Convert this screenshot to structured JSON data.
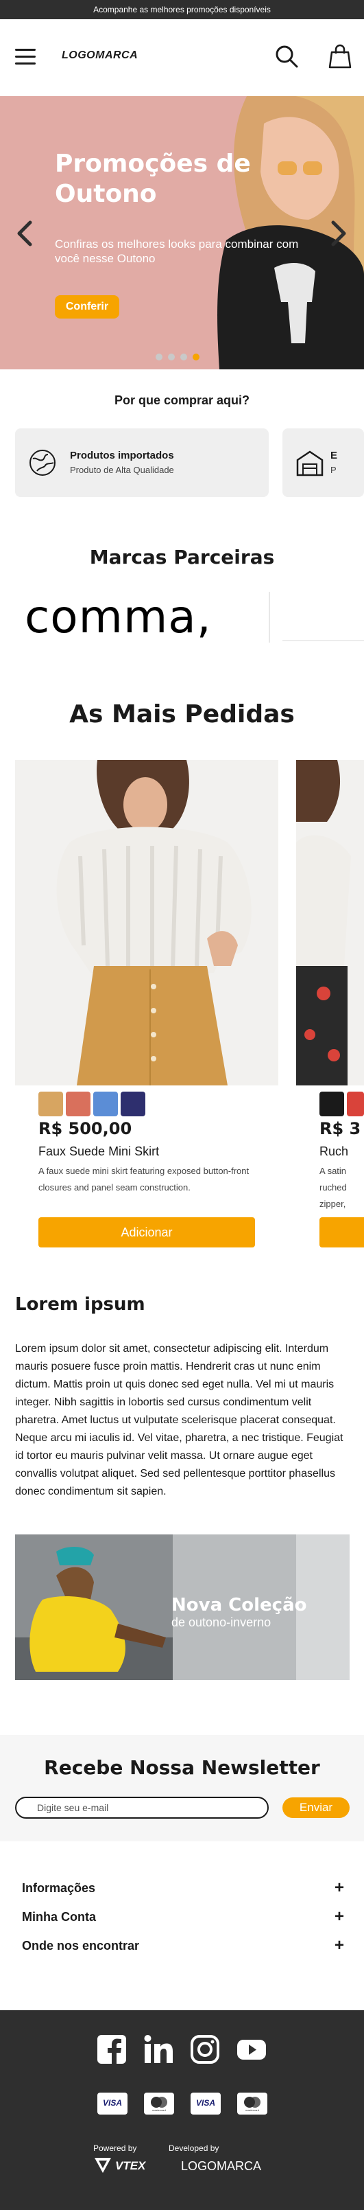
{
  "topbar": {
    "message": "Acompanhe as melhores promoções disponíveis"
  },
  "header": {
    "logo": "LOGOMARCA",
    "icons": [
      "menu-icon",
      "search-icon",
      "bag-icon"
    ]
  },
  "hero": {
    "title": "Promoções de Outono",
    "subtitle": "Confiras os melhores looks para combinar com você nesse Outono",
    "button": "Conferir",
    "slides": 4,
    "active_slide": 4
  },
  "why": {
    "title": "Por que comprar aqui?",
    "features": [
      {
        "title": "Produtos importados",
        "subtitle": "Produto de Alta Qualidade",
        "icon": "globe-icon"
      },
      {
        "title": "E",
        "subtitle": "P",
        "icon": "warehouse-icon"
      }
    ]
  },
  "brands": {
    "title": "Marcas Parceiras",
    "items": [
      "comma,"
    ]
  },
  "bestsellers": {
    "title": "As Mais Pedidas",
    "products": [
      {
        "colors": [
          "#D7A561",
          "#D9705C",
          "#5B8DD6",
          "#2E2F6E"
        ],
        "price": "R$ 500,00",
        "name": "Faux Suede Mini Skirt",
        "description": "A faux suede mini skirt featuring exposed button-front closures and panel seam construction.",
        "button": "Adicionar"
      },
      {
        "colors": [
          "#1A1A1A",
          "#D9433A"
        ],
        "price": "R$ 3",
        "name": "Ruch",
        "description": "A satin\nruched\nzipper,",
        "button": ""
      }
    ]
  },
  "lorem": {
    "title": "Lorem ipsum",
    "text": "Lorem ipsum dolor sit amet, consectetur adipiscing elit. Interdum mauris posuere fusce proin mattis. Hendrerit cras ut nunc enim dictum. Mattis proin ut quis donec sed eget nulla. Vel mi ut mauris integer. Nibh sagittis in lobortis sed cursus condimentum velit pharetra. Amet luctus ut vulputate scelerisque placerat consequat. Neque arcu mi iaculis id. Vel vitae, pharetra, a nec tristique. Feugiat id tortor eu mauris pulvinar velit massa. Ut ornare augue eget convallis volutpat aliquet. Sed sed pellentesque porttitor phasellus donec condimentum sit sapien."
  },
  "banner": {
    "title": "Nova Coleção",
    "subtitle": "de outono-inverno"
  },
  "newsletter": {
    "title": "Recebe Nossa Newsletter",
    "placeholder": "Digite seu e-mail",
    "button": "Enviar"
  },
  "accordion": [
    {
      "label": "Informações",
      "toggle": "+"
    },
    {
      "label": "Minha Conta",
      "toggle": "+"
    },
    {
      "label": "Onde nos encontrar",
      "toggle": "+"
    }
  ],
  "footer": {
    "social": [
      "facebook-icon",
      "linkedin-icon",
      "instagram-icon",
      "youtube-icon"
    ],
    "payments": [
      "VISA",
      "mastercard",
      "VISA",
      "mastercard"
    ],
    "powered_by": "Powered by",
    "powered_brand": "VTEX",
    "developed_by": "Developed by",
    "developer": "LOGOMARCA"
  },
  "colors": {
    "accent": "#F7A400",
    "dark": "#2F2F2F",
    "hero_bg": "#DEA19C"
  }
}
